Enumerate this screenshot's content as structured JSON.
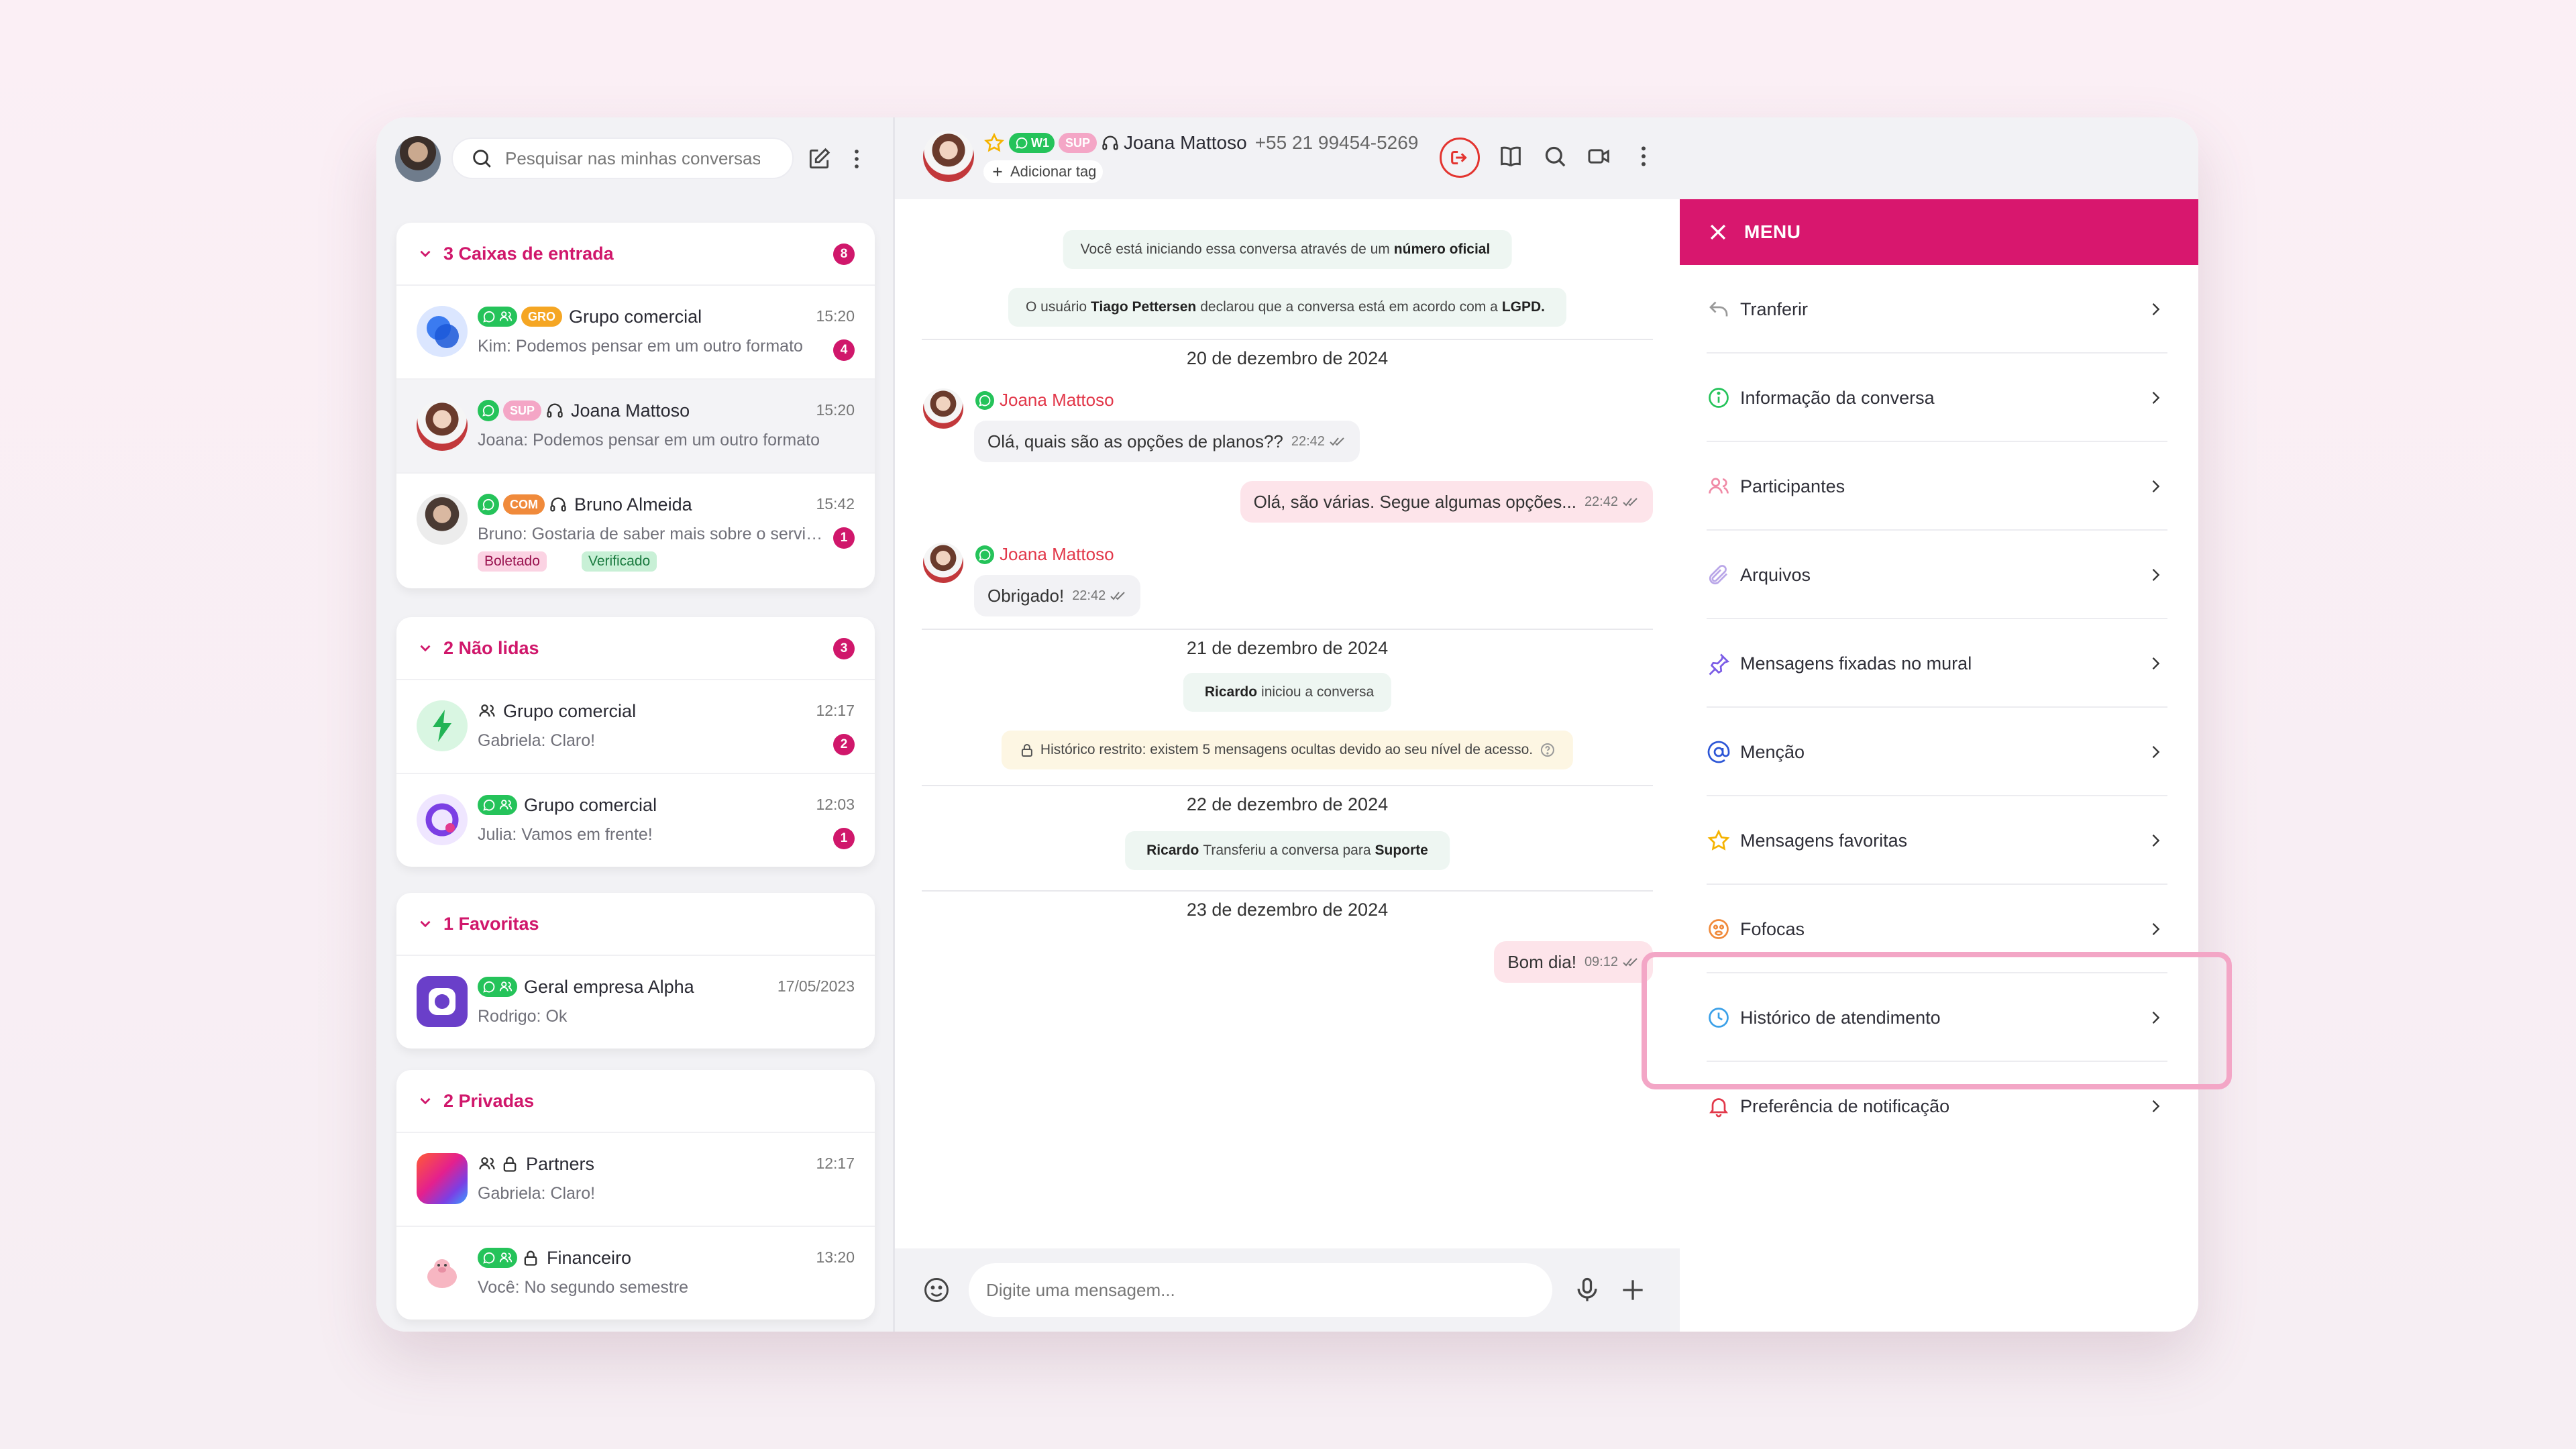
{
  "search": {
    "placeholder": "Pesquisar nas minhas conversas"
  },
  "groups": [
    {
      "title": "3 Caixas de entrada",
      "count": "8",
      "conversations": [
        {
          "tag": "GRO",
          "name": "Grupo comercial",
          "time": "15:20",
          "preview": "Kim: Podemos pensar em um outro formato",
          "unread": "4"
        },
        {
          "tag": "SUP",
          "name": "Joana Mattoso",
          "time": "15:20",
          "preview": "Joana: Podemos pensar em um outro formato"
        },
        {
          "tag": "COM",
          "name": "Bruno Almeida",
          "time": "15:42",
          "preview": "Bruno: Gostaria de saber mais sobre o servi…",
          "unread": "1",
          "chips": [
            "Boletado",
            "Verificado"
          ]
        }
      ]
    },
    {
      "title": "2 Não lidas",
      "count": "3",
      "conversations": [
        {
          "name": "Grupo comercial",
          "time": "12:17",
          "preview": "Gabriela: Claro!",
          "unread": "2"
        },
        {
          "name": "Grupo comercial",
          "time": "12:03",
          "preview": "Julia: Vamos em frente!",
          "unread": "1"
        }
      ]
    },
    {
      "title": "1 Favoritas",
      "conversations": [
        {
          "name": "Geral empresa Alpha",
          "time": "17/05/2023",
          "preview": "Rodrigo: Ok"
        }
      ]
    },
    {
      "title": "2 Privadas",
      "conversations": [
        {
          "name": "Partners",
          "time": "12:17",
          "preview": "Gabriela: Claro!"
        },
        {
          "name": "Financeiro",
          "time": "13:20",
          "preview": "Você: No segundo semestre"
        }
      ]
    }
  ],
  "chat_header": {
    "channel": "W1",
    "tag": "SUP",
    "name": "Joana Mattoso",
    "phone": "+55 21 99454-5269",
    "add_tag": "Adicionar tag"
  },
  "chat": {
    "sys1_pre": "Você está iniciando essa conversa através de um",
    "sys1_bold": "número oficial",
    "sys2_pre": "O usuário",
    "sys2_bold1": "Tiago Pettersen",
    "sys2_mid": "declarou que a conversa está em acordo com a",
    "sys2_bold2": "LGPD.",
    "date1": "20 de dezembro de 2024",
    "sender": "Joana Mattoso",
    "msg1": "Olá, quais são as opções de planos??",
    "msg1_time": "22:42",
    "msg2": "Olá, são várias. Segue algumas opções...",
    "msg2_time": "22:42",
    "msg3": "Obrigado!",
    "msg3_time": "22:42",
    "date2": "21 de dezembro de 2024",
    "sys3_bold": "Ricardo",
    "sys3_text": "iniciou a conversa",
    "warn_text": "Histórico restrito: existem 5 mensagens ocultas devido ao seu nível de acesso.",
    "date3": "22 de dezembro de 2024",
    "sys4_bold1": "Ricardo",
    "sys4_mid": "Transferiu a conversa para",
    "sys4_bold2": "Suporte",
    "date4": "23 de dezembro de 2024",
    "msg4": "Bom dia!",
    "msg4_time": "09:12"
  },
  "composer": {
    "placeholder": "Digite uma mensagem..."
  },
  "menu": {
    "title": "MENU",
    "items": [
      {
        "label": "Tranferir",
        "icon": "reply-icon"
      },
      {
        "label": "Informação da conversa",
        "icon": "info-icon"
      },
      {
        "label": "Participantes",
        "icon": "people-icon"
      },
      {
        "label": "Arquivos",
        "icon": "paperclip-icon"
      },
      {
        "label": "Mensagens fixadas no mural",
        "icon": "pin-icon"
      },
      {
        "label": "Menção",
        "icon": "at-icon"
      },
      {
        "label": "Mensagens favoritas",
        "icon": "star-icon"
      },
      {
        "label": "Fofocas",
        "icon": "gossip-icon"
      },
      {
        "label": "Histórico de atendimento",
        "icon": "clock-icon"
      },
      {
        "label": "Preferência de  notificação",
        "icon": "bell-icon"
      }
    ]
  },
  "colors": {
    "accent": "#d8176e",
    "whatsapp": "#25c35a",
    "highlight": "#f3a6c6"
  }
}
